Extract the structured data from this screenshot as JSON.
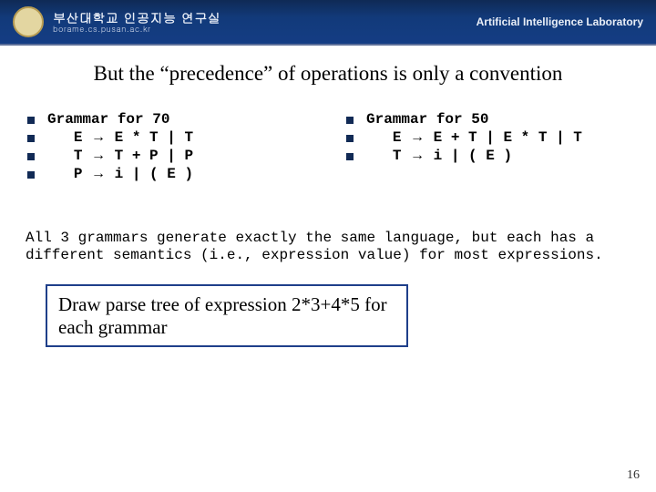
{
  "header": {
    "org_main": "부산대학교 인공지능 연구실",
    "org_sub": "borame.cs.pusan.ac.kr",
    "lab": "Artificial Intelligence Laboratory"
  },
  "title": "But the “precedence” of operations is only a convention",
  "arrow": "→",
  "left": {
    "heading": "Grammar for 70",
    "rules": [
      {
        "lhs": "E",
        "rhs": "E * T | T"
      },
      {
        "lhs": "T",
        "rhs": "T + P | P"
      },
      {
        "lhs": "P",
        "rhs": "i | ( E )"
      }
    ]
  },
  "right": {
    "heading": "Grammar for 50",
    "rules": [
      {
        "lhs": "E",
        "rhs": "E + T | E * T | T"
      },
      {
        "lhs": "T",
        "rhs": "i | ( E )"
      }
    ]
  },
  "paragraph": "All 3 grammars generate exactly the same language, but each has a different semantics (i.e., expression value) for most expressions.",
  "callout": "Draw parse tree of expression 2*3+4*5 for each grammar",
  "page_number": "16"
}
